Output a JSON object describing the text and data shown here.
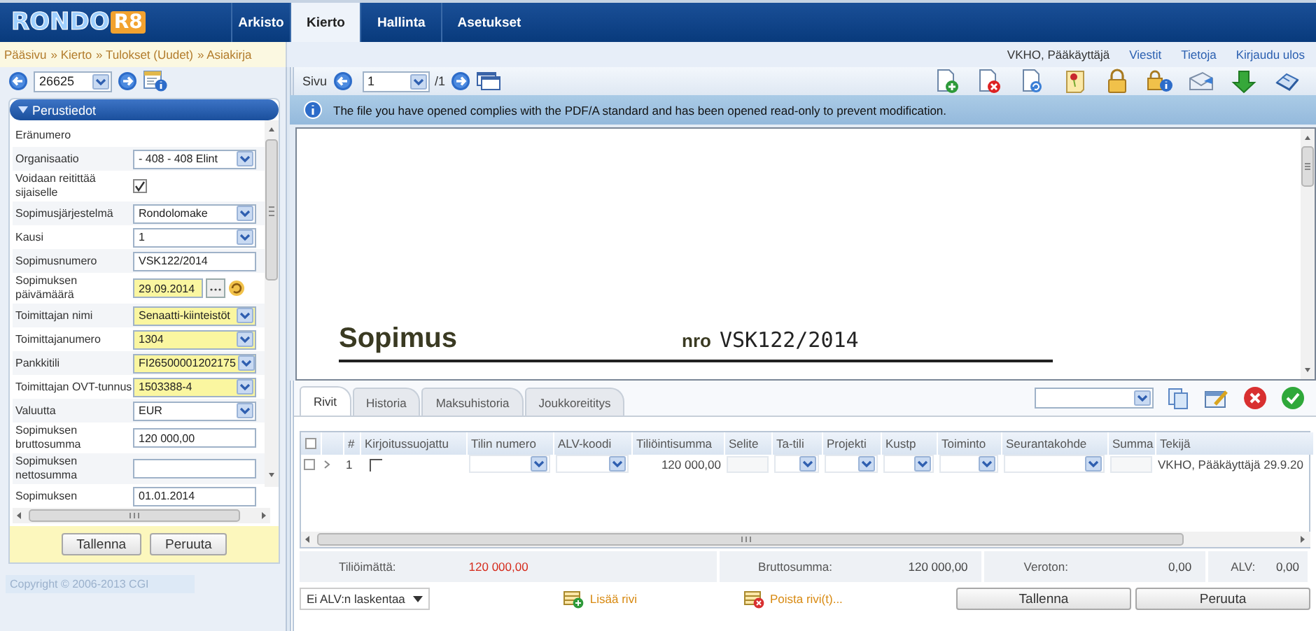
{
  "app": {
    "logo_text": "RONDO",
    "logo_badge": "R8"
  },
  "top_tabs": [
    {
      "label": "Arkisto",
      "selected": false
    },
    {
      "label": "Kierto",
      "selected": true
    },
    {
      "label": "Hallinta",
      "selected": false
    },
    {
      "label": "Asetukset",
      "selected": false
    }
  ],
  "breadcrumbs": [
    "Pääsivu",
    "» Kierto",
    "» Tulokset (Uudet)",
    "» Asiakirja"
  ],
  "user": "VKHO, Pääkäyttäjä",
  "header_links": [
    "Viestit",
    "Tietoja",
    "Kirjaudu ulos"
  ],
  "record_nav": {
    "value": "26625"
  },
  "panel": {
    "title": "Perustiedot",
    "expanded": true
  },
  "fields": [
    {
      "label": "Eränumero",
      "kind": "none"
    },
    {
      "label": "Organisaatio",
      "kind": "select",
      "value": "- 408 - 408 Elint",
      "highlight": false
    },
    {
      "label": "Voidaan reitittää sijaiselle",
      "kind": "checkbox",
      "checked": true
    },
    {
      "label": "Sopimusjärjestelmä",
      "kind": "select",
      "value": "Rondolomake",
      "highlight": false
    },
    {
      "label": "Kausi",
      "kind": "select",
      "value": "1",
      "highlight": false
    },
    {
      "label": "Sopimusnumero",
      "kind": "text",
      "value": "VSK122/2014",
      "highlight": false
    },
    {
      "label": "Sopimuksen päivämäärä",
      "kind": "date",
      "value": "29.09.2014",
      "highlight": true
    },
    {
      "label": "Toimittajan nimi",
      "kind": "select",
      "value": "Senaatti-kiinteistöt",
      "highlight": true
    },
    {
      "label": "Toimittajanumero",
      "kind": "select",
      "value": "1304",
      "highlight": true
    },
    {
      "label": "Pankkitili",
      "kind": "select",
      "value": "FI26500001202175",
      "highlight": true
    },
    {
      "label": "Toimittajan OVT-tunnus",
      "kind": "select",
      "value": "1503388-4",
      "highlight": true
    },
    {
      "label": "Valuutta",
      "kind": "select",
      "value": "EUR",
      "highlight": false
    },
    {
      "label": "Sopimuksen bruttosumma",
      "kind": "text",
      "value": "120 000,00",
      "highlight": false
    },
    {
      "label": "Sopimuksen nettosumma",
      "kind": "text",
      "highlight": false
    },
    {
      "label": "Sopimuksen",
      "kind": "text",
      "value": "01.01.2014",
      "highlight": false
    }
  ],
  "panel_buttons": [
    "Tallenna",
    "Peruuta"
  ],
  "copyright": "Copyright © 2006-2013 CGI",
  "viewer": {
    "page_label": "Sivu",
    "page": "1",
    "page_total": "/1",
    "message": "The file you have opened complies with the PDF/A standard and has been opened read-only to prevent modification.",
    "doc_title": "Sopimus",
    "doc_number_label": "nro",
    "doc_number": "VSK122/2014"
  },
  "grid_tabs": [
    {
      "label": "Rivit",
      "selected": true
    },
    {
      "label": "Historia",
      "selected": false
    },
    {
      "label": "Maksuhistoria",
      "selected": false
    },
    {
      "label": "Joukkoreititys",
      "selected": false
    }
  ],
  "columns": [
    {
      "label": "#",
      "kind": "number"
    },
    {
      "label": "Kirjoitussuojattu",
      "kind": "check"
    },
    {
      "label": "Tilin numero",
      "kind": "select"
    },
    {
      "label": "ALV-koodi",
      "kind": "select"
    },
    {
      "label": "Tiliöintisumma",
      "kind": "amount"
    },
    {
      "label": "Selite",
      "kind": "input"
    },
    {
      "label": "Ta-tili",
      "kind": "select"
    },
    {
      "label": "Projekti",
      "kind": "select"
    },
    {
      "label": "Kustp",
      "kind": "select"
    },
    {
      "label": "Toiminto",
      "kind": "select"
    },
    {
      "label": "Seurantakohde",
      "kind": "select"
    },
    {
      "label": "Summa",
      "kind": "input"
    },
    {
      "label": "Tekijä",
      "kind": "author"
    }
  ],
  "select_all": false,
  "rows": [
    {
      "selected": false,
      "number": "1",
      "write_protected": false,
      "amount": "120 000,00",
      "author": "VKHO, Pääkäyttäjä 29.9.20"
    }
  ],
  "totals": [
    {
      "label": "Tiliöimättä:",
      "value": "120 000,00",
      "alert": true
    },
    {
      "label": "Bruttosumma:",
      "value": "120 000,00",
      "alert": false
    },
    {
      "label": "Veroton:",
      "value": "0,00",
      "alert": false
    },
    {
      "label": "ALV:",
      "value": "0,00",
      "alert": false
    }
  ],
  "vat_mode": "Ei ALV:n laskentaa",
  "row_actions": [
    {
      "label": "Lisää rivi",
      "kind": "add"
    },
    {
      "label": "Poista rivi(t)...",
      "kind": "remove"
    }
  ],
  "grid_buttons": [
    "Tallenna",
    "Peruuta"
  ]
}
